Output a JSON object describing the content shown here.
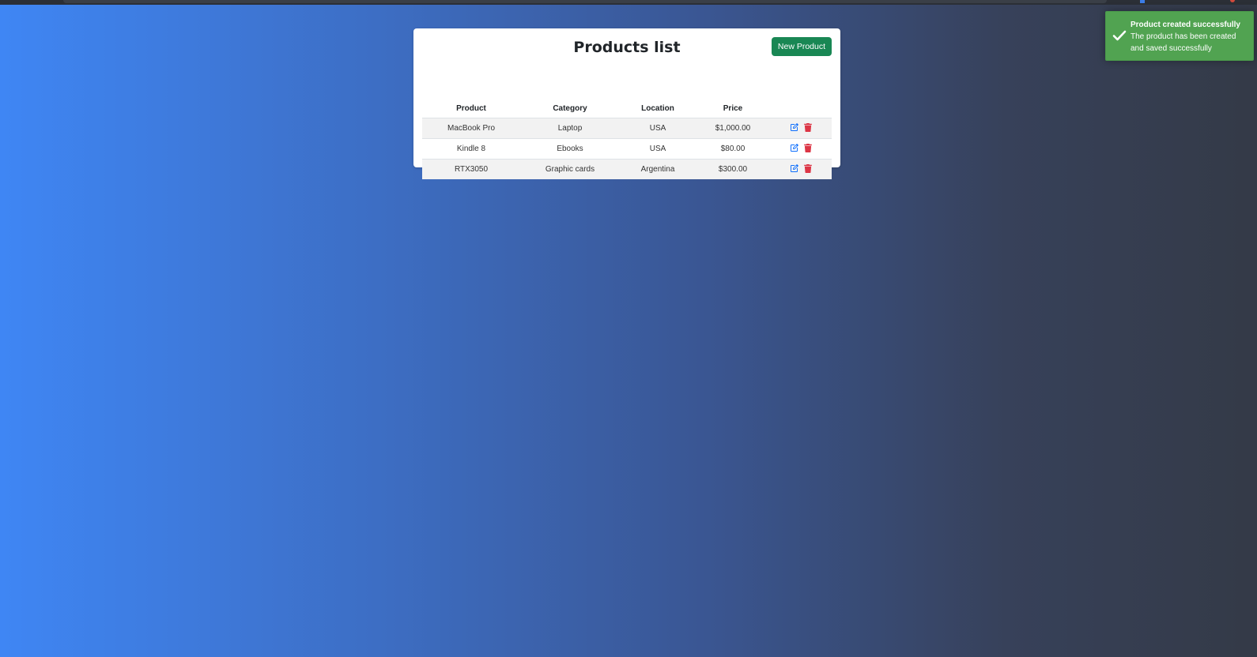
{
  "header": {
    "title": "Products list",
    "new_button_label": "New Product"
  },
  "table": {
    "columns": [
      "Product",
      "Category",
      "Location",
      "Price",
      ""
    ],
    "rows": [
      {
        "product": "MacBook Pro",
        "category": "Laptop",
        "location": "USA",
        "price": "$1,000.00"
      },
      {
        "product": "Kindle 8",
        "category": "Ebooks",
        "location": "USA",
        "price": "$80.00"
      },
      {
        "product": "RTX3050",
        "category": "Graphic cards",
        "location": "Argentina",
        "price": "$300.00"
      }
    ],
    "edit_icon": "edit-icon",
    "delete_icon": "trash-icon"
  },
  "toast": {
    "title": "Product created successfully",
    "message": "The product has been created and saved successfully",
    "icon": "check-icon"
  },
  "colors": {
    "accent_green": "#198754",
    "toast_green": "#51a351",
    "edit_blue": "#0d6efd",
    "delete_red": "#dc3545"
  }
}
